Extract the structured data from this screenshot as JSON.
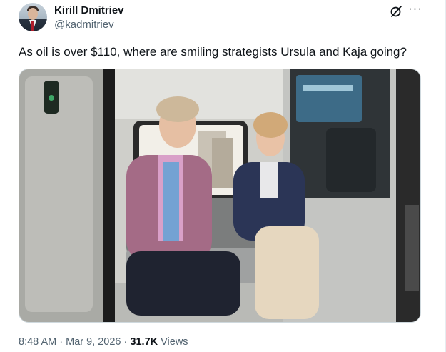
{
  "author": {
    "display_name": "Kirill Dmitriev",
    "handle": "@kadmitriev"
  },
  "header_icons": [
    "grok-icon",
    "more-options-icon"
  ],
  "more_glyph": "···",
  "tweet": {
    "text": "As oil is over $110, where are smiling strategists Ursula and Kaja going?"
  },
  "meta": {
    "time": "8:48 AM",
    "separator": "·",
    "date": "Mar 9, 2026",
    "views_count": "31.7K",
    "views_label": "Views"
  }
}
